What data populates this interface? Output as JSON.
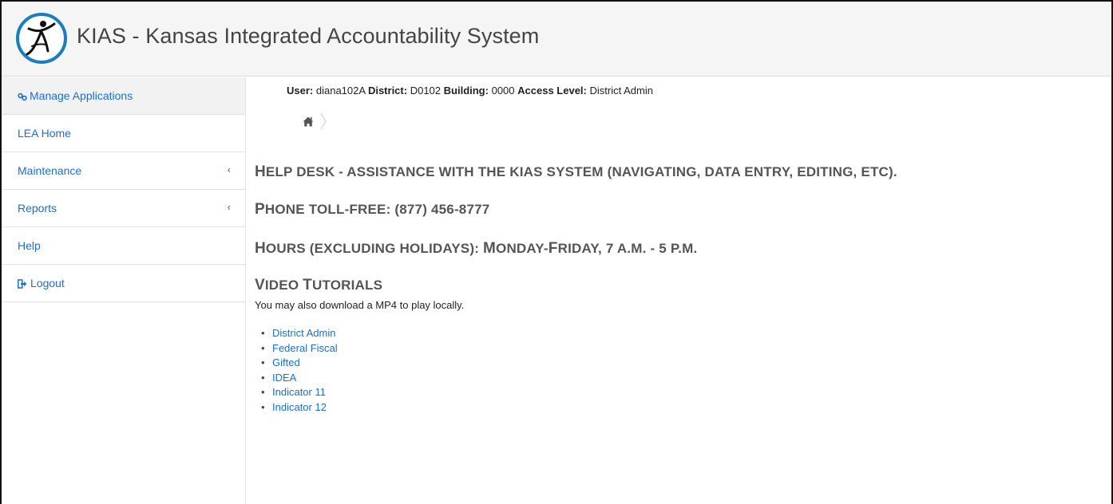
{
  "header": {
    "title": "KIAS - Kansas Integrated Accountability System"
  },
  "sidebar": {
    "items": [
      {
        "label": "Manage Applications",
        "icon": "link-icon"
      },
      {
        "label": "LEA Home"
      },
      {
        "label": "Maintenance",
        "expandable": true
      },
      {
        "label": "Reports",
        "expandable": true
      },
      {
        "label": "Help"
      },
      {
        "label": "Logout",
        "icon": "logout-icon"
      }
    ],
    "chevron": "‹"
  },
  "user_info": {
    "user_label": "User:",
    "user_value": "diana102A",
    "district_label": "District:",
    "district_value": "D0102",
    "building_label": "Building:",
    "building_value": "0000",
    "access_label": "Access Level:",
    "access_value": "District Admin"
  },
  "content": {
    "helpdesk_cap": "H",
    "helpdesk_rest": "elp Desk - assistance with the KIAS system (navigating, data entry, editing, etc).",
    "phone_cap": "P",
    "phone_rest": "hone toll-free: (877) 456-8777",
    "hours_cap": "H",
    "hours_mid": "ours (excluding holidays): ",
    "hours_cap2": "M",
    "hours_mid2": "onday-",
    "hours_cap3": "F",
    "hours_mid3": "riday, 7 ",
    "hours_am": "a.m.",
    "hours_dash": " - 5 ",
    "hours_pm": "p.m.",
    "video_cap": "V",
    "video_mid": "ideo ",
    "video_cap2": "T",
    "video_rest": "utorials",
    "note": "You may also download a MP4 to play locally.",
    "tutorials": [
      "District Admin",
      "Federal Fiscal",
      "Gifted",
      "IDEA",
      "Indicator 11",
      "Indicator 12"
    ]
  },
  "colors": {
    "link": "#1a6fd1",
    "heading": "#555555",
    "header_bg": "#f5f5f5"
  }
}
